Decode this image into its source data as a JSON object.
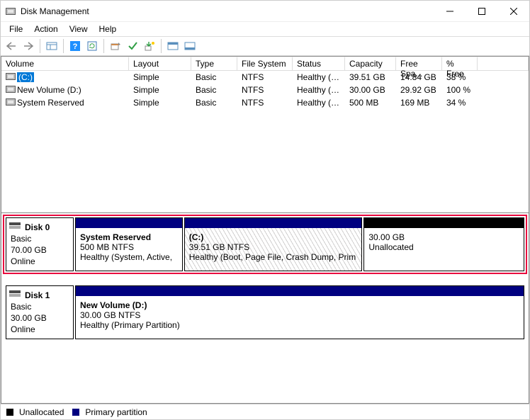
{
  "window": {
    "title": "Disk Management"
  },
  "menu": {
    "file": "File",
    "action": "Action",
    "view": "View",
    "help": "Help"
  },
  "columns": {
    "volume": "Volume",
    "layout": "Layout",
    "type": "Type",
    "fs": "File System",
    "status": "Status",
    "capacity": "Capacity",
    "free": "Free Spa...",
    "pct": "% Free"
  },
  "volumes": [
    {
      "name": "(C:)",
      "layout": "Simple",
      "type": "Basic",
      "fs": "NTFS",
      "status": "Healthy (B...",
      "capacity": "39.51 GB",
      "free": "14.84 GB",
      "pct": "38 %",
      "selected": true
    },
    {
      "name": "New Volume (D:)",
      "layout": "Simple",
      "type": "Basic",
      "fs": "NTFS",
      "status": "Healthy (P...",
      "capacity": "30.00 GB",
      "free": "29.92 GB",
      "pct": "100 %",
      "selected": false
    },
    {
      "name": "System Reserved",
      "layout": "Simple",
      "type": "Basic",
      "fs": "NTFS",
      "status": "Healthy (S...",
      "capacity": "500 MB",
      "free": "169 MB",
      "pct": "34 %",
      "selected": false
    }
  ],
  "disks": [
    {
      "name": "Disk 0",
      "type": "Basic",
      "size": "70.00 GB",
      "state": "Online",
      "highlight": true,
      "partitions": [
        {
          "title": "System Reserved",
          "sub": "500 MB NTFS",
          "status": "Healthy (System, Active,",
          "bar": "blue",
          "hatch": false,
          "flex": 1.2
        },
        {
          "title": "(C:)",
          "sub": "39.51 GB NTFS",
          "status": "Healthy (Boot, Page File, Crash Dump, Prim",
          "bar": "blue",
          "hatch": true,
          "flex": 2.0
        },
        {
          "title": "",
          "sub": "30.00 GB",
          "status": "Unallocated",
          "bar": "black",
          "hatch": false,
          "flex": 1.8
        }
      ]
    },
    {
      "name": "Disk 1",
      "type": "Basic",
      "size": "30.00 GB",
      "state": "Online",
      "highlight": false,
      "partitions": [
        {
          "title": "New Volume  (D:)",
          "sub": "30.00 GB NTFS",
          "status": "Healthy (Primary Partition)",
          "bar": "blue",
          "hatch": false,
          "flex": 1
        }
      ]
    }
  ],
  "legend": {
    "unalloc": "Unallocated",
    "primary": "Primary partition"
  },
  "icons": {
    "back": "back-arrow",
    "forward": "forward-arrow",
    "up": "tree-toggle",
    "help": "help-icon",
    "refresh": "refresh-icon",
    "props": "properties-icon",
    "check": "check-icon",
    "arrow": "action-icon",
    "grid": "grid-icon",
    "list": "layout-icon"
  }
}
